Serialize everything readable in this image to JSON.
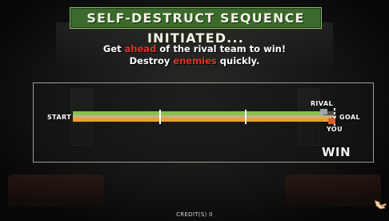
{
  "banner": {
    "title": "SELF-DESTRUCT SEQUENCE INITIATED..."
  },
  "instructions": {
    "line1_pre": "Get ",
    "line1_highlight": "ahead",
    "line1_post": " of the rival team to win!",
    "line2_pre": "Destroy ",
    "line2_highlight": "enemies",
    "line2_post": " quickly."
  },
  "race": {
    "start_label": "START",
    "goal_label": "GOAL",
    "rival_label": "RIVAL",
    "you_label": "YOU",
    "rival_progress": 0.96,
    "you_progress": 0.99,
    "checkpoints": [
      0.33,
      0.66
    ],
    "result": "WIN"
  },
  "footer": {
    "credits": "CREDIT(S) 0"
  },
  "colors": {
    "banner_bg": "#3c6a2c",
    "highlight": "#e8332a",
    "rival_bar": "#86c24a",
    "you_bar": "#e9a12c"
  },
  "icons": {
    "corner": "hand-pointer-icon"
  }
}
